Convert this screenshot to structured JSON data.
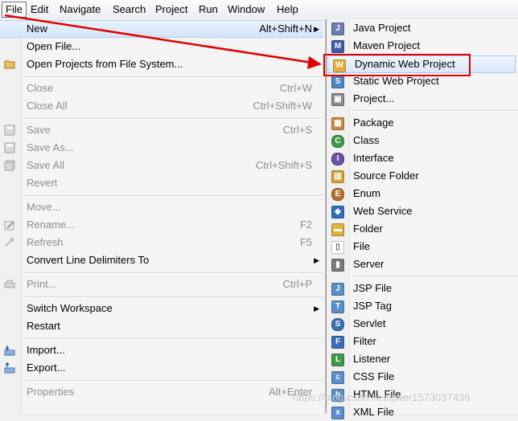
{
  "menubar": [
    "File",
    "Edit",
    "Navigate",
    "Search",
    "Project",
    "Run",
    "Window",
    "Help"
  ],
  "file_menu": [
    {
      "label": "New",
      "shortcut": "Alt+Shift+N",
      "submenu": true,
      "state": "highlighted",
      "icon": ""
    },
    {
      "label": "Open File...",
      "shortcut": "",
      "state": "enabled",
      "icon": ""
    },
    {
      "label": "Open Projects from File System...",
      "shortcut": "",
      "state": "enabled",
      "icon": "folder-icon"
    },
    {
      "label": "Close",
      "shortcut": "Ctrl+W",
      "state": "disabled",
      "icon": ""
    },
    {
      "label": "Close All",
      "shortcut": "Ctrl+Shift+W",
      "state": "disabled",
      "icon": ""
    },
    {
      "label": "Save",
      "shortcut": "Ctrl+S",
      "state": "disabled",
      "icon": "save-icon"
    },
    {
      "label": "Save As...",
      "shortcut": "",
      "state": "disabled",
      "icon": "save-as-icon"
    },
    {
      "label": "Save All",
      "shortcut": "Ctrl+Shift+S",
      "state": "disabled",
      "icon": "save-all-icon"
    },
    {
      "label": "Revert",
      "shortcut": "",
      "state": "disabled",
      "icon": ""
    },
    {
      "label": "Move...",
      "shortcut": "",
      "state": "disabled",
      "icon": ""
    },
    {
      "label": "Rename...",
      "shortcut": "F2",
      "state": "disabled",
      "icon": "rename-icon"
    },
    {
      "label": "Refresh",
      "shortcut": "F5",
      "state": "disabled",
      "icon": "refresh-icon"
    },
    {
      "label": "Convert Line Delimiters To",
      "shortcut": "",
      "submenu": true,
      "state": "enabled",
      "icon": ""
    },
    {
      "label": "Print...",
      "shortcut": "Ctrl+P",
      "state": "disabled",
      "icon": "print-icon"
    },
    {
      "label": "Switch Workspace",
      "shortcut": "",
      "submenu": true,
      "state": "enabled",
      "icon": ""
    },
    {
      "label": "Restart",
      "shortcut": "",
      "state": "enabled",
      "icon": ""
    },
    {
      "label": "Import...",
      "shortcut": "",
      "state": "enabled",
      "icon": "import-icon"
    },
    {
      "label": "Export...",
      "shortcut": "",
      "state": "enabled",
      "icon": "export-icon"
    },
    {
      "label": "Properties",
      "shortcut": "Alt+Enter",
      "state": "disabled",
      "icon": ""
    }
  ],
  "new_submenu": [
    {
      "label": "Java Project",
      "icon": "java-project-icon",
      "color": "#6b7fb6"
    },
    {
      "label": "Maven Project",
      "icon": "maven-project-icon",
      "color": "#3d5ea8"
    },
    {
      "label": "Dynamic Web Project",
      "icon": "web-project-icon",
      "color": "#e2b13c",
      "state": "highlighted"
    },
    {
      "label": "Static Web Project",
      "icon": "static-web-project-icon",
      "color": "#4c84c4"
    },
    {
      "label": "Project...",
      "icon": "project-icon",
      "color": "#8a8a8a"
    },
    {
      "label": "Package",
      "icon": "package-icon",
      "color": "#c98a3e"
    },
    {
      "label": "Class",
      "icon": "class-icon",
      "color": "#3e9a4a"
    },
    {
      "label": "Interface",
      "icon": "interface-icon",
      "color": "#6a4fa2"
    },
    {
      "label": "Source Folder",
      "icon": "source-folder-icon",
      "color": "#d7a437"
    },
    {
      "label": "Enum",
      "icon": "enum-icon",
      "color": "#b3702e"
    },
    {
      "label": "Web Service",
      "icon": "web-service-icon",
      "color": "#2f6fb8"
    },
    {
      "label": "Folder",
      "icon": "folder-icon",
      "color": "#e2b13c"
    },
    {
      "label": "File",
      "icon": "file-icon",
      "color": "#ffffff"
    },
    {
      "label": "Server",
      "icon": "server-icon",
      "color": "#7a7a7a"
    },
    {
      "label": "JSP File",
      "icon": "jsp-file-icon",
      "color": "#5b8fc9"
    },
    {
      "label": "JSP Tag",
      "icon": "jsp-tag-icon",
      "color": "#5b8fc9"
    },
    {
      "label": "Servlet",
      "icon": "servlet-icon",
      "color": "#3b6fb6"
    },
    {
      "label": "Filter",
      "icon": "filter-icon",
      "color": "#3b6fb6"
    },
    {
      "label": "Listener",
      "icon": "listener-icon",
      "color": "#3e9a4a"
    },
    {
      "label": "CSS File",
      "icon": "css-file-icon",
      "color": "#5b8fc9"
    },
    {
      "label": "HTML File",
      "icon": "html-file-icon",
      "color": "#5b8fc9"
    },
    {
      "label": "XML File",
      "icon": "xml-file-icon",
      "color": "#5b8fc9"
    }
  ],
  "annotation_color": "#e50000",
  "watermark": "https://blog.csdn.net/qwer1573037436"
}
